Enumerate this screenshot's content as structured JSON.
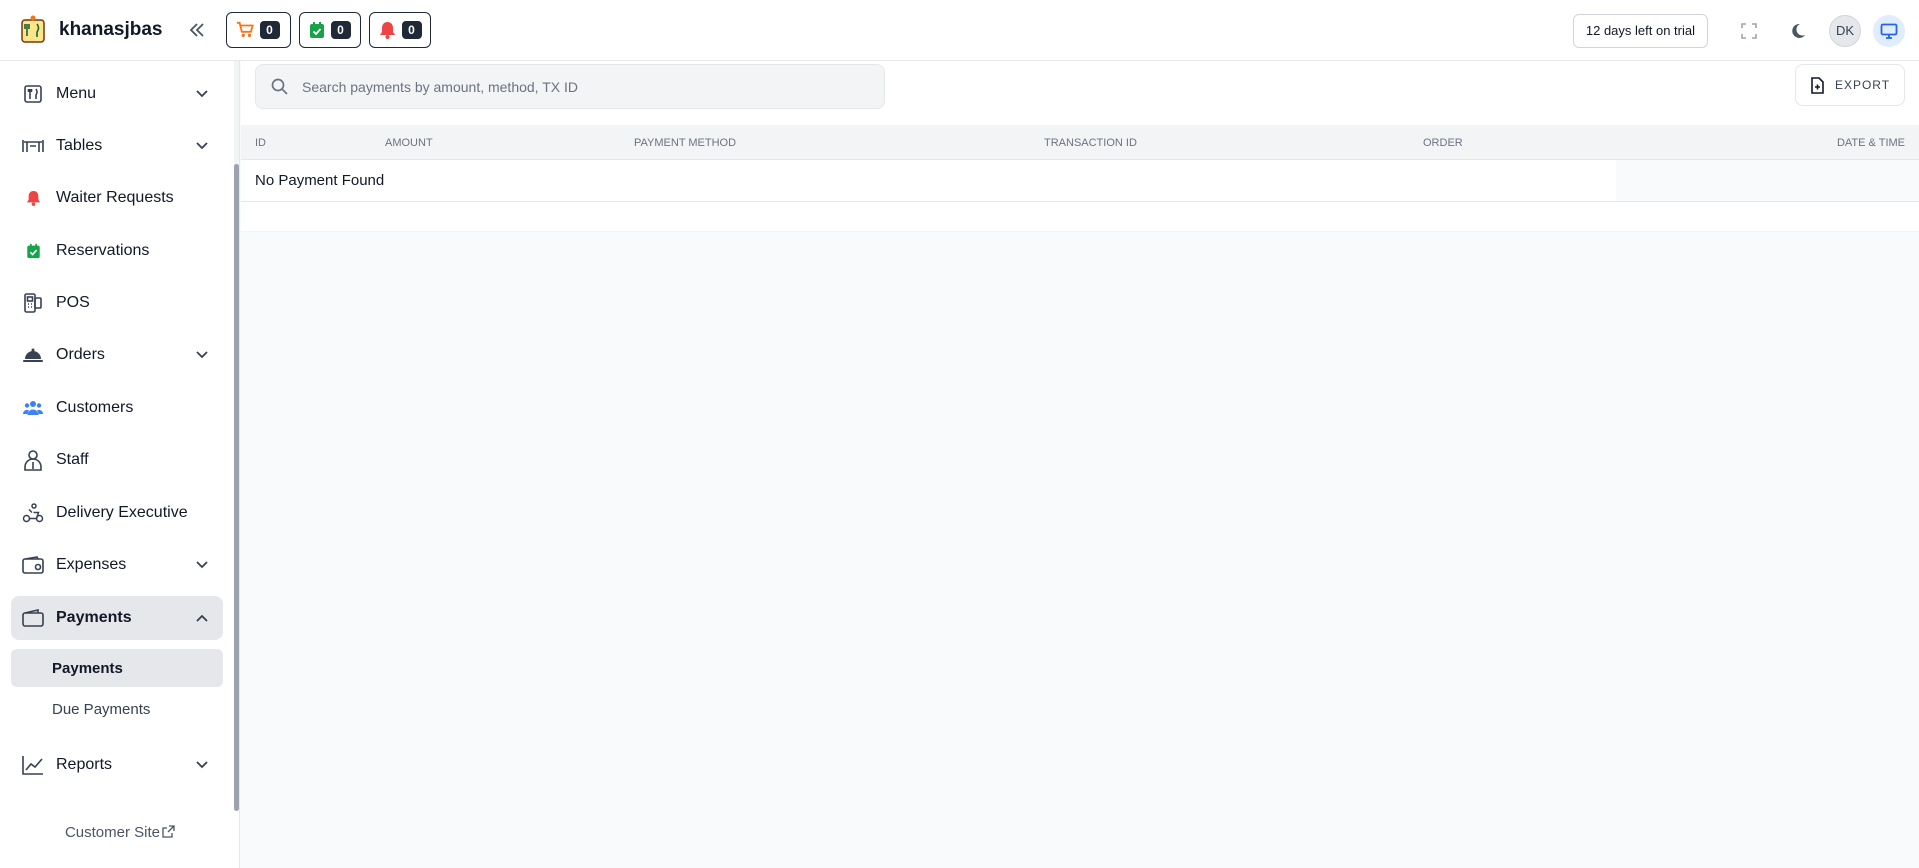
{
  "header": {
    "restaurant_name": "khanasjbas",
    "counters": [
      {
        "icon": "cart-icon",
        "count": "0",
        "color": "#f97316"
      },
      {
        "icon": "calendar-check-icon",
        "count": "0",
        "color": "#16a34a"
      },
      {
        "icon": "bell-icon",
        "count": "0",
        "color": "#ef4444"
      }
    ],
    "trial_text": "12 days left on trial",
    "avatar_initials": "DK"
  },
  "sidebar": {
    "items": [
      {
        "label": "Menu",
        "icon": "menu-book-icon",
        "has_chevron": true
      },
      {
        "label": "Tables",
        "icon": "table-icon",
        "has_chevron": true
      },
      {
        "label": "Waiter Requests",
        "icon": "bell-icon",
        "has_chevron": false
      },
      {
        "label": "Reservations",
        "icon": "calendar-check-icon",
        "has_chevron": false
      },
      {
        "label": "POS",
        "icon": "pos-terminal-icon",
        "has_chevron": false
      },
      {
        "label": "Orders",
        "icon": "food-cloche-icon",
        "has_chevron": true
      },
      {
        "label": "Customers",
        "icon": "users-icon",
        "has_chevron": false
      },
      {
        "label": "Staff",
        "icon": "staff-icon",
        "has_chevron": false
      },
      {
        "label": "Delivery Executive",
        "icon": "scooter-icon",
        "has_chevron": false
      },
      {
        "label": "Expenses",
        "icon": "wallet-icon",
        "has_chevron": true
      },
      {
        "label": "Payments",
        "icon": "wallet-icon",
        "has_chevron": true,
        "expanded": true,
        "active": true
      },
      {
        "label": "Reports",
        "icon": "chart-line-icon",
        "has_chevron": true
      }
    ],
    "payments_sub": [
      {
        "label": "Payments",
        "active": true
      },
      {
        "label": "Due Payments",
        "active": false
      }
    ],
    "customer_site": "Customer Site"
  },
  "main": {
    "search_placeholder": "Search payments by amount, method, TX ID",
    "export_label": "EXPORT",
    "columns": [
      "ID",
      "AMOUNT",
      "PAYMENT METHOD",
      "TRANSACTION ID",
      "ORDER",
      "DATE & TIME"
    ],
    "empty_message": "No Payment Found"
  },
  "colors": {
    "accent_blue": "#2563eb",
    "orders_orange": "#f97316",
    "reservations_green": "#16a34a",
    "waiter_red": "#ef4444"
  }
}
